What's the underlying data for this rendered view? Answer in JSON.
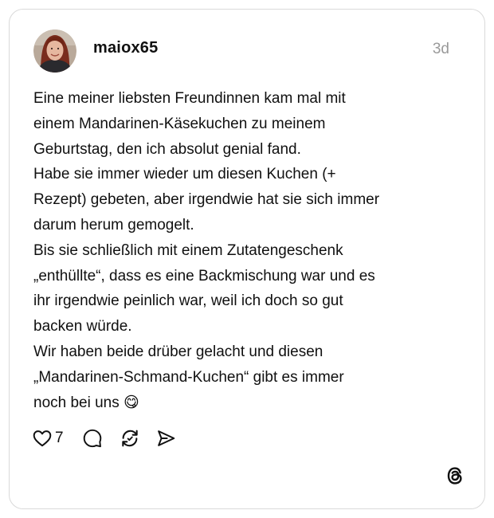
{
  "post": {
    "username": "maiox65",
    "timestamp": "3d",
    "lines": [
      "Eine meiner liebsten Freundinnen kam mal mit",
      "einem Mandarinen-Käsekuchen zu meinem",
      "Geburtstag, den ich absolut genial fand.",
      "Habe sie immer wieder um diesen Kuchen (+",
      "Rezept) gebeten, aber irgendwie hat sie sich immer",
      "darum herum gemogelt.",
      "Bis sie schließlich mit einem Zutatengeschenk",
      "„enthüllte“, dass es eine Backmischung war und es",
      "ihr irgendwie peinlich war, weil ich doch so gut",
      "backen würde.",
      "Wir haben beide drüber gelacht und diesen",
      "„Mandarinen-Schmand-Kuchen“ gibt es immer",
      "noch bei uns"
    ],
    "emoji": "😋",
    "like_count": "7"
  },
  "icons": {
    "like": "heart-icon",
    "comment": "comment-bubble-icon",
    "repost": "repost-icon",
    "share": "send-icon",
    "logo": "threads-logo-icon"
  },
  "colors": {
    "text": "#101010",
    "muted": "#9a9a9a",
    "border": "#d9d9d9"
  }
}
